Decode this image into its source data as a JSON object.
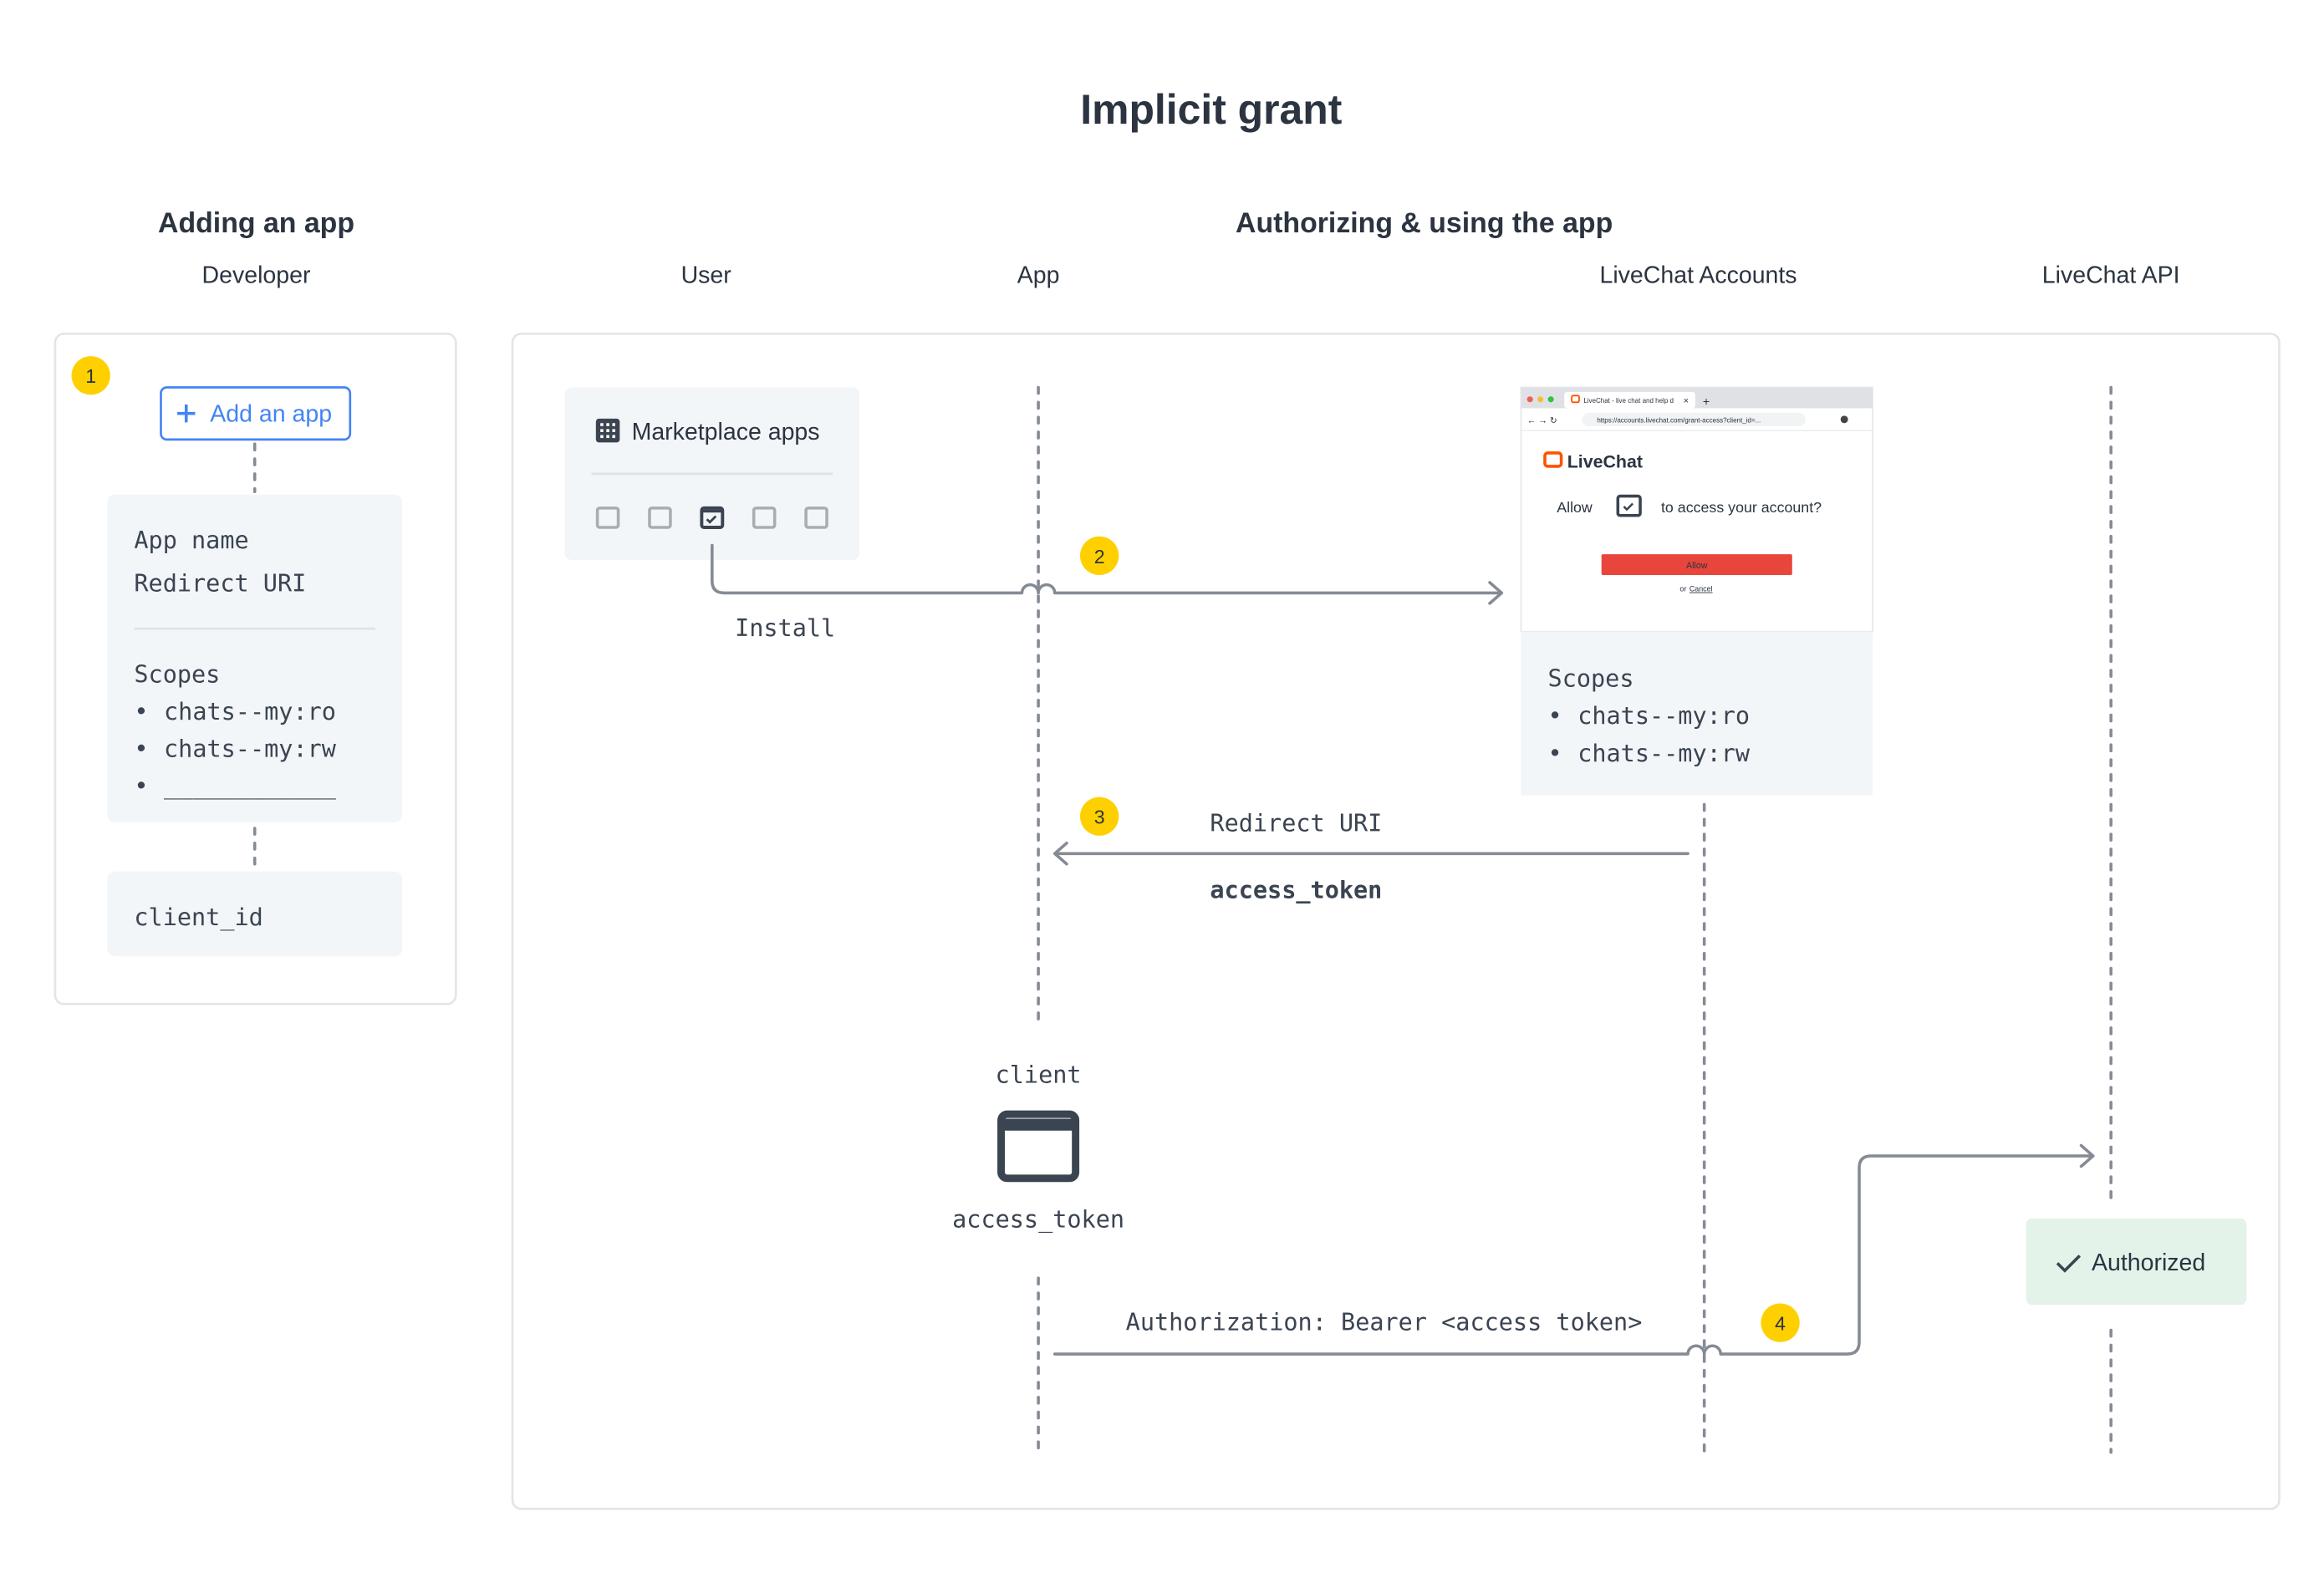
{
  "title": "Implicit grant",
  "sections": {
    "adding": "Adding an app",
    "authorizing": "Authorizing & using the app"
  },
  "actors": {
    "developer": "Developer",
    "user": "User",
    "app": "App",
    "accounts": "LiveChat Accounts",
    "api": "LiveChat API"
  },
  "colors": {
    "accent_blue": "#4384f5",
    "badge_yellow": "#ffd000",
    "allow_red": "#e8453c",
    "authorized_bg": "#e3f3ea",
    "card_bg": "#f3f6f9",
    "line_gray": "#858b94"
  },
  "steps": [
    "1",
    "2",
    "3",
    "4"
  ],
  "developer": {
    "add_button": "Add an app",
    "add_icon": "plus-icon",
    "fields": [
      "App name",
      "Redirect URI"
    ],
    "scopes_label": "Scopes",
    "scopes": [
      "chats--my:ro",
      "chats--my:rw",
      "____________"
    ],
    "client_id": "client_id"
  },
  "marketplace": {
    "title": "Marketplace apps",
    "icon": "grid-icon",
    "install_label": "Install"
  },
  "browser": {
    "tab_title": "LiveChat - live chat and help d",
    "url": "https://accounts.livechat.com/grant-access?client_id=...",
    "brand": "LiveChat",
    "allow_prefix": "Allow",
    "allow_suffix": "to access your account?",
    "allow_button": "Allow",
    "or": "or",
    "cancel": "Cancel"
  },
  "accounts_scopes": {
    "label": "Scopes",
    "items": [
      "chats--my:ro",
      "chats--my:rw"
    ]
  },
  "redirect": {
    "label": "Redirect URI",
    "token": "access_token"
  },
  "client": {
    "label": "client",
    "token": "access_token"
  },
  "api_call": {
    "header": "Authorization: Bearer <access token>"
  },
  "authorized": {
    "label": "Authorized",
    "icon": "check-icon"
  }
}
